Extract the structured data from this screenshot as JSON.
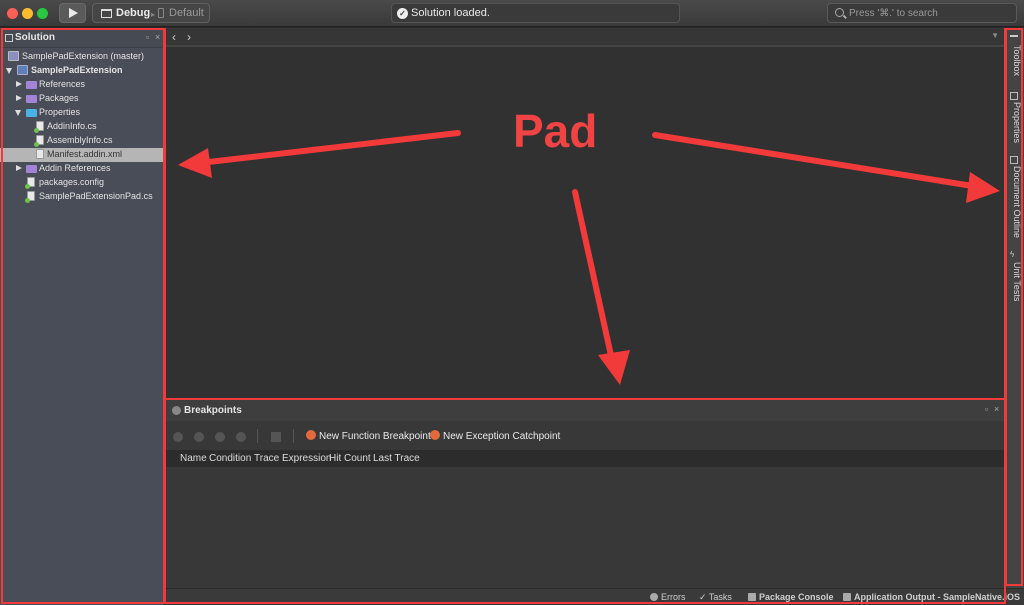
{
  "toolbar": {
    "config_label": "Debug",
    "device_label": "Default",
    "status_text": "Solution loaded.",
    "search_placeholder": "Press '⌘.' to search"
  },
  "solution_pad": {
    "title": "Solution",
    "tree": [
      {
        "label": "SamplePadExtension (master)",
        "icon": "solution-icon"
      },
      {
        "label": "SamplePadExtension",
        "icon": "project-icon",
        "bold": true
      },
      {
        "label": "References",
        "icon": "folder-icon"
      },
      {
        "label": "Packages",
        "icon": "folder-icon"
      },
      {
        "label": "Properties",
        "icon": "folder-icon"
      },
      {
        "label": "AddinInfo.cs",
        "icon": "csharp-file-icon"
      },
      {
        "label": "AssemblyInfo.cs",
        "icon": "csharp-file-icon"
      },
      {
        "label": "Manifest.addin.xml",
        "icon": "xml-file-icon",
        "selected": true
      },
      {
        "label": "Addin References",
        "icon": "folder-icon"
      },
      {
        "label": "packages.config",
        "icon": "config-file-icon"
      },
      {
        "label": "SamplePadExtensionPad.cs",
        "icon": "csharp-file-icon"
      }
    ]
  },
  "breakpoints_pad": {
    "title": "Breakpoints",
    "new_function_breakpoint": "New Function Breakpoint",
    "new_exception_catchpoint": "New Exception Catchpoint",
    "columns": [
      "Name",
      "Condition",
      "Trace Expression",
      "Hit Count",
      "Last Trace"
    ]
  },
  "right_toolbar": [
    "Toolbox",
    "Properties",
    "Document Outline",
    "Unit Tests"
  ],
  "statusbar": {
    "errors": "Errors",
    "tasks": "Tasks",
    "package_console": "Package Console",
    "application_output": "Application Output - SampleNative.iOS"
  },
  "annotation": {
    "label": "Pad",
    "color": "#f23a3a"
  }
}
